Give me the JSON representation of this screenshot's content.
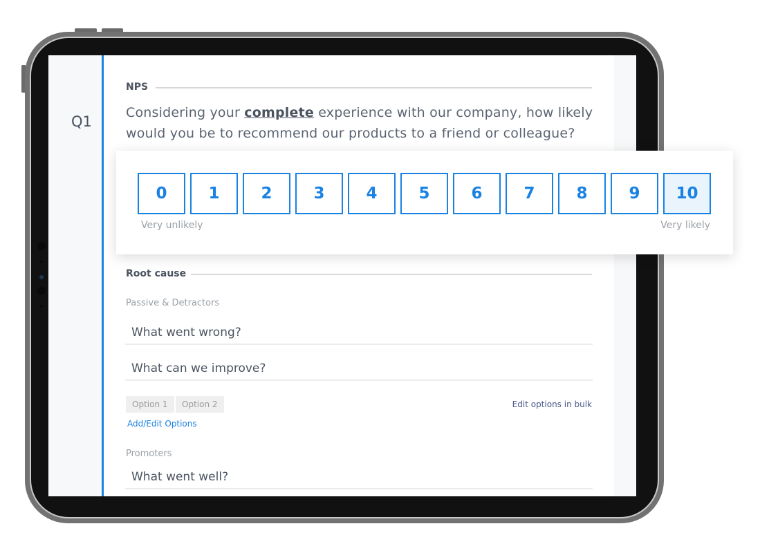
{
  "question": {
    "number": "Q1",
    "section": "NPS",
    "text_before": "Considering your ",
    "emphasis": "complete",
    "text_after": " experience with our company, how likely would you be to recommend our products to a friend or colleague?"
  },
  "scale": {
    "values": [
      "0",
      "1",
      "2",
      "3",
      "4",
      "5",
      "6",
      "7",
      "8",
      "9",
      "10"
    ],
    "selected": "10",
    "low_label": "Very unlikely",
    "high_label": "Very likely"
  },
  "root_cause": {
    "title": "Root cause",
    "detractors_label": "Passive & Detractors",
    "fields": [
      "What went wrong?",
      "What can we improve?"
    ],
    "options": [
      "Option 1",
      "Option 2"
    ],
    "edit_bulk": "Edit options in bulk",
    "add_edit": "Add/Edit Options",
    "promoters_label": "Promoters",
    "promoter_field": "What went well?"
  },
  "colors": {
    "accent": "#1a82e2",
    "text": "#4a5360"
  }
}
